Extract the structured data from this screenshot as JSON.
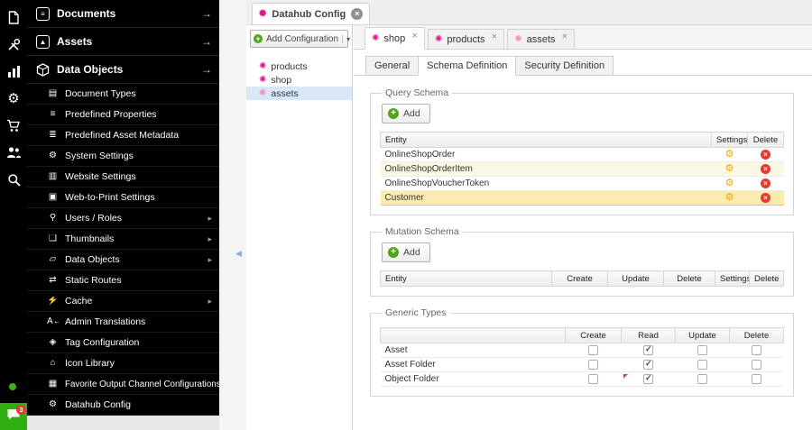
{
  "colors": {
    "accent_green": "#52a317",
    "accent_pink": "#d81b8c",
    "rail_chat_green": "#2fae12",
    "selected_row_yellow": "#f9ecae",
    "delete_red": "#e23c30",
    "gear_yellow": "#f2a40e",
    "tree_selection_blue": "#d9e8f7"
  },
  "rail": {
    "icons": [
      {
        "name": "documents"
      },
      {
        "name": "tools"
      },
      {
        "name": "reports"
      },
      {
        "name": "settings"
      },
      {
        "name": "ecommerce"
      },
      {
        "name": "users"
      },
      {
        "name": "search"
      }
    ],
    "chat_badge": "3"
  },
  "sidebar": {
    "sections": [
      {
        "label": "Documents",
        "icon": "documents-section"
      },
      {
        "label": "Assets",
        "icon": "assets-section"
      },
      {
        "label": "Data Objects",
        "icon": "data-objects-section"
      }
    ],
    "items": [
      {
        "label": "Document Types",
        "icon": "document-types"
      },
      {
        "label": "Predefined Properties",
        "icon": "sliders"
      },
      {
        "label": "Predefined Asset Metadata",
        "icon": "metadata"
      },
      {
        "label": "System Settings",
        "icon": "gear"
      },
      {
        "label": "Website Settings",
        "icon": "equalizer"
      },
      {
        "label": "Web-to-Print Settings",
        "icon": "printer"
      },
      {
        "label": "Users / Roles",
        "icon": "user",
        "submenu": true
      },
      {
        "label": "Thumbnails",
        "icon": "thumbnails",
        "submenu": true
      },
      {
        "label": "Data Objects",
        "icon": "cube",
        "submenu": true
      },
      {
        "label": "Static Routes",
        "icon": "routes"
      },
      {
        "label": "Cache",
        "icon": "lightning",
        "submenu": true
      },
      {
        "label": "Admin Translations",
        "icon": "translate"
      },
      {
        "label": "Tag Configuration",
        "icon": "tag"
      },
      {
        "label": "Icon Library",
        "icon": "library"
      },
      {
        "label": "Favorite Output Channel Configurations",
        "icon": "grid"
      },
      {
        "label": "Datahub Config",
        "icon": "hub"
      }
    ]
  },
  "window": {
    "tab": {
      "label": "Datahub Config",
      "icon": "pink-star",
      "close": "×"
    }
  },
  "tree": {
    "add_button": {
      "label": "Add Configuration"
    },
    "items": [
      {
        "label": "products",
        "icon": "pink-star"
      },
      {
        "label": "shop",
        "icon": "pink-star"
      },
      {
        "label": "assets",
        "icon": "pink-star-light",
        "selected": true
      }
    ]
  },
  "main": {
    "tabs": [
      {
        "label": "shop",
        "icon": "pink-star",
        "active": true,
        "close": "✕"
      },
      {
        "label": "products",
        "icon": "pink-star",
        "close": "✕"
      },
      {
        "label": "assets",
        "icon": "pink-star-light",
        "close": "✕"
      }
    ],
    "subtabs": [
      {
        "label": "General"
      },
      {
        "label": "Schema Definition",
        "active": true
      },
      {
        "label": "Security Definition"
      }
    ],
    "query_schema": {
      "legend": "Query Schema",
      "add_label": "Add",
      "columns": [
        "Entity",
        "Settings",
        "Delete"
      ],
      "rows": [
        {
          "entity": "OnlineShopOrder"
        },
        {
          "entity": "OnlineShopOrderItem"
        },
        {
          "entity": "OnlineShopVoucherToken"
        },
        {
          "entity": "Customer",
          "selected": true
        }
      ]
    },
    "mutation_schema": {
      "legend": "Mutation Schema",
      "add_label": "Add",
      "columns": [
        "Entity",
        "Create",
        "Update",
        "Delete",
        "Settings",
        "Delete"
      ]
    },
    "generic_types": {
      "legend": "Generic Types",
      "columns": [
        "",
        "Create",
        "Read",
        "Update",
        "Delete"
      ],
      "rows": [
        {
          "label": "Asset",
          "create": false,
          "read": true,
          "update": false,
          "delete": false
        },
        {
          "label": "Asset Folder",
          "create": false,
          "read": true,
          "update": false,
          "delete": false
        },
        {
          "label": "Object Folder",
          "create": false,
          "read": true,
          "update": false,
          "delete": false,
          "dirty": true
        }
      ]
    }
  }
}
